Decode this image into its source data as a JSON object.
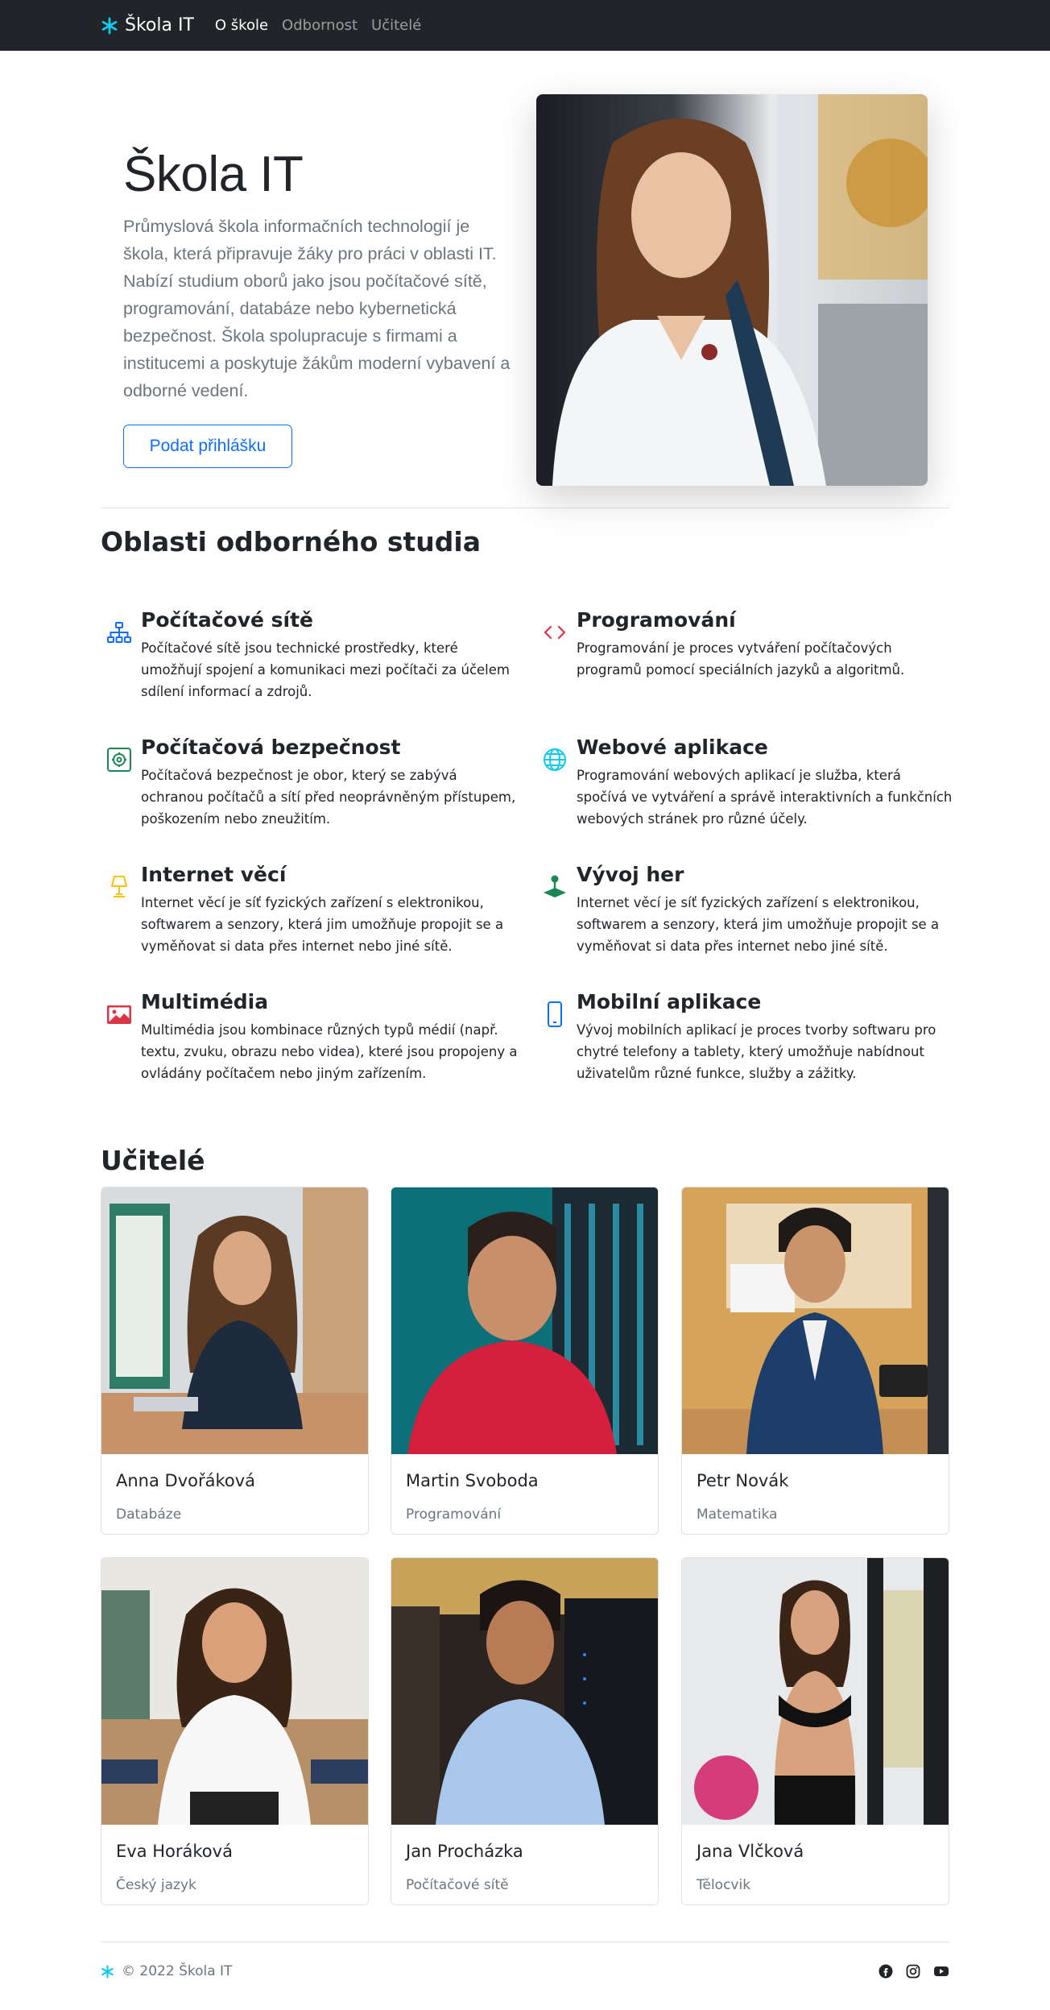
{
  "nav": {
    "brand": "Škola IT",
    "links": [
      "O škole",
      "Odbornost",
      "Učitelé"
    ]
  },
  "hero": {
    "title": "Škola IT",
    "lead": "Průmyslová škola informačních technologií je škola, která připravuje žáky pro práci v oblasti IT. Nabízí studium oborů jako jsou počítačové sítě, programování, databáze nebo kybernetická bezpečnost. Škola spolupracuje s firmami a institucemi a poskytuje žákům moderní vybavení a odborné vedení.",
    "button": "Podat přihlášku"
  },
  "features": {
    "heading": "Oblasti odborného studia",
    "items": [
      {
        "icon": "network-icon",
        "title": "Počítačové sítě",
        "text": "Počítačové sítě jsou technické prostředky, které umožňují spojení a komunikaci mezi počítači za účelem sdílení informací a zdrojů."
      },
      {
        "icon": "code-icon",
        "title": "Programování",
        "text": "Programování je proces vytváření počítačových programů pomocí speciálních jazyků a algoritmů."
      },
      {
        "icon": "safe-icon",
        "title": "Počítačová bezpečnost",
        "text": "Počítačová bezpečnost je obor, který se zabývá ochranou počítačů a sítí před neoprávněným přístupem, poškozením nebo zneužitím."
      },
      {
        "icon": "globe-icon",
        "title": "Webové aplikace",
        "text": "Programování webových aplikací je služba, která spočívá ve vytváření a správě interaktivních a funkčních webových stránek pro různé účely."
      },
      {
        "icon": "lamp-icon",
        "title": "Internet věcí",
        "text": "Internet věcí je síť fyzických zařízení s elektronikou, softwarem a senzory, která jim umožňuje propojit se a vyměňovat si data přes internet nebo jiné sítě."
      },
      {
        "icon": "joystick-icon",
        "title": "Vývoj her",
        "text": "Internet věcí je síť fyzických zařízení s elektronikou, softwarem a senzory, která jim umožňuje propojit se a vyměňovat si data přes internet nebo jiné sítě."
      },
      {
        "icon": "image-icon",
        "title": "Multimédia",
        "text": "Multimédia jsou kombinace různých typů médií (např. textu, zvuku, obrazu nebo videa), které jsou propojeny a ovládány počítačem nebo jiným zařízením."
      },
      {
        "icon": "phone-icon",
        "title": "Mobilní aplikace",
        "text": "Vývoj mobilních aplikací je proces tvorby softwaru pro chytré telefony a tablety, který umožňuje nabídnout uživatelům různé funkce, služby a zážitky."
      }
    ]
  },
  "teachers": {
    "heading": "Učitelé",
    "items": [
      {
        "name": "Anna Dvořáková",
        "subject": "Databáze"
      },
      {
        "name": "Martin Svoboda",
        "subject": "Programování"
      },
      {
        "name": "Petr Novák",
        "subject": "Matematika"
      },
      {
        "name": "Eva Horáková",
        "subject": "Český jazyk"
      },
      {
        "name": "Jan Procházka",
        "subject": "Počítačové sítě"
      },
      {
        "name": "Jana Vlčková",
        "subject": "Tělocvik"
      }
    ]
  },
  "footer": {
    "copyright": "© 2022 Škola IT",
    "icons": [
      "facebook-icon",
      "instagram-icon",
      "youtube-icon"
    ]
  },
  "colors": {
    "navbar": "#212529",
    "primary": "#0d6efd",
    "brand_asterisk": "#0dcaf0",
    "muted": "#6c757d"
  }
}
